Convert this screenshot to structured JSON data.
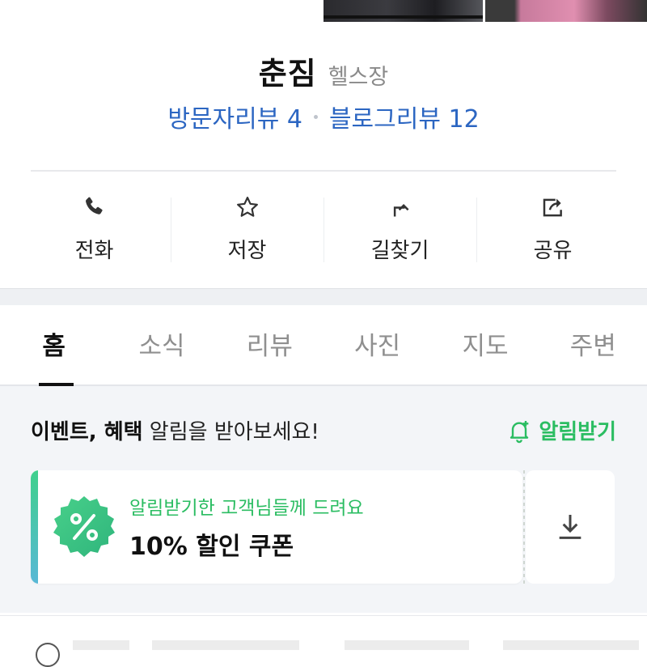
{
  "place": {
    "name": "춘짐",
    "category": "헬스장",
    "visitor_review": "방문자리뷰 4",
    "blog_review": "블로그리뷰 12"
  },
  "actions": [
    {
      "label": "전화",
      "icon": "phone-icon"
    },
    {
      "label": "저장",
      "icon": "star-icon"
    },
    {
      "label": "길찾기",
      "icon": "directions-icon"
    },
    {
      "label": "공유",
      "icon": "share-icon"
    }
  ],
  "tabs": [
    {
      "label": "홈",
      "active": true
    },
    {
      "label": "소식",
      "active": false
    },
    {
      "label": "리뷰",
      "active": false
    },
    {
      "label": "사진",
      "active": false
    },
    {
      "label": "지도",
      "active": false
    },
    {
      "label": "주변",
      "active": false
    }
  ],
  "notice": {
    "text_bold": "이벤트, 혜택",
    "text_rest": " 알림을 받아보세요!",
    "button_label": "알림받기",
    "button_icon": "bell-plus-icon"
  },
  "coupon": {
    "subtitle": "알림받기한 고객님들께 드려요",
    "title": "10% 할인 쿠폰",
    "badge_icon": "percent-badge-icon",
    "download_icon": "download-icon"
  },
  "colors": {
    "link_blue": "#2c66c2",
    "accent_green": "#2bbd62",
    "tab_active": "#111111",
    "tab_inactive": "#8f8f8f"
  }
}
